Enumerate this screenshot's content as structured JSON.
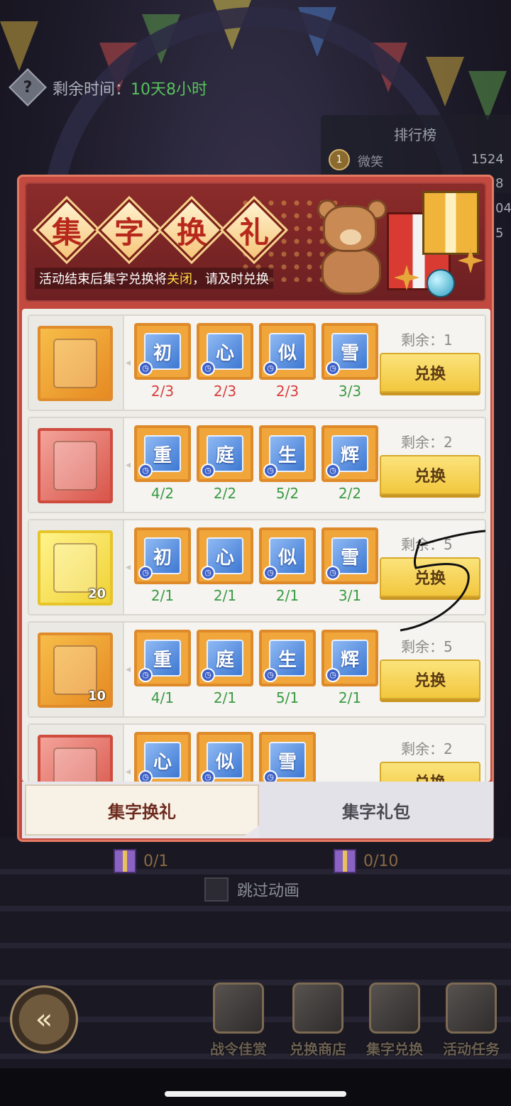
{
  "top": {
    "help_icon": "question-icon",
    "timer_label": "剩余时间：",
    "timer_value": "10天8小时"
  },
  "ranking": {
    "title": "排行榜",
    "badge": "1",
    "name": "微笑",
    "score": "1524",
    "edge_values": [
      "8",
      "04",
      "5"
    ]
  },
  "banner": {
    "title_chars": [
      "集",
      "字",
      "换",
      "礼"
    ],
    "notice_pre": "活动结束后集字兑换将",
    "notice_highlight": "关闭",
    "notice_post": "，请及时兑换"
  },
  "rows": [
    {
      "reward_icon": "hero-card-icon",
      "reward_qty": "",
      "chars": [
        {
          "char": "初",
          "count": "2/3",
          "status": "red"
        },
        {
          "char": "心",
          "count": "2/3",
          "status": "red"
        },
        {
          "char": "似",
          "count": "2/3",
          "status": "red"
        },
        {
          "char": "雪",
          "count": "3/3",
          "status": "green"
        }
      ],
      "remain": "剩余：1",
      "button": "兑换"
    },
    {
      "reward_icon": "red-chest-icon",
      "reward_qty": "",
      "chars": [
        {
          "char": "重",
          "count": "4/2",
          "status": "green"
        },
        {
          "char": "庭",
          "count": "2/2",
          "status": "green"
        },
        {
          "char": "生",
          "count": "5/2",
          "status": "green"
        },
        {
          "char": "辉",
          "count": "2/2",
          "status": "green"
        }
      ],
      "remain": "剩余：2",
      "button": "兑换"
    },
    {
      "reward_icon": "winged-chest-icon",
      "reward_qty": "20",
      "chars": [
        {
          "char": "初",
          "count": "2/1",
          "status": "green"
        },
        {
          "char": "心",
          "count": "2/1",
          "status": "green"
        },
        {
          "char": "似",
          "count": "2/1",
          "status": "green"
        },
        {
          "char": "雪",
          "count": "3/1",
          "status": "green"
        }
      ],
      "remain": "剩余：5",
      "button": "兑换"
    },
    {
      "reward_icon": "card-chest-icon",
      "reward_qty": "10",
      "chars": [
        {
          "char": "重",
          "count": "4/1",
          "status": "green"
        },
        {
          "char": "庭",
          "count": "2/1",
          "status": "green"
        },
        {
          "char": "生",
          "count": "5/1",
          "status": "green"
        },
        {
          "char": "辉",
          "count": "2/1",
          "status": "green"
        }
      ],
      "remain": "剩余：5",
      "button": "兑换"
    },
    {
      "reward_icon": "weapon-icon",
      "reward_qty": "",
      "chars": [
        {
          "char": "心",
          "count": "",
          "status": "green"
        },
        {
          "char": "似",
          "count": "",
          "status": "green"
        },
        {
          "char": "雪",
          "count": "",
          "status": "green"
        }
      ],
      "remain": "剩余：2",
      "button": "兑换"
    }
  ],
  "tabs": {
    "active": "集字换礼",
    "inactive": "集字礼包"
  },
  "under_panel": {
    "gift_left": "0/1",
    "gift_right": "0/10",
    "skip_label": "跳过动画"
  },
  "nav": {
    "back_icon": "back-arrow-icon",
    "items": [
      {
        "label": "战令佳赏",
        "icon": "battle-pass-icon"
      },
      {
        "label": "兑换商店",
        "icon": "shop-icon"
      },
      {
        "label": "集字兑换",
        "icon": "word-exchange-icon"
      },
      {
        "label": "活动任务",
        "icon": "task-icon"
      }
    ]
  },
  "colors": {
    "panel": "#c1493f",
    "button": "#f2c73e",
    "count_red": "#d93d3d",
    "count_green": "#3a9a43",
    "timer_green": "#57c35b"
  }
}
